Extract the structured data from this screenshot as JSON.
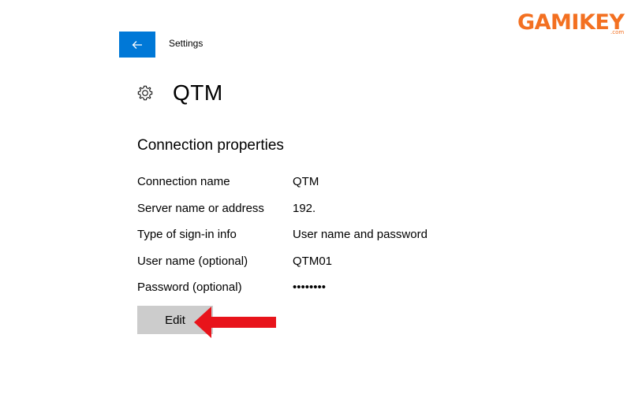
{
  "header": {
    "back_icon": "arrow-left-icon",
    "app_title": "Settings"
  },
  "page": {
    "icon": "gear-icon",
    "title": "QTM"
  },
  "section": {
    "title": "Connection properties"
  },
  "properties": [
    {
      "label": "Connection name",
      "value": "QTM"
    },
    {
      "label": "Server name or address",
      "value": "192."
    },
    {
      "label": "Type of sign-in info",
      "value": "User name and password"
    },
    {
      "label": "User name (optional)",
      "value": "QTM01"
    },
    {
      "label": "Password (optional)",
      "value": "••••••••"
    }
  ],
  "actions": {
    "edit_label": "Edit"
  },
  "annotation": {
    "arrow_color": "#e8141b",
    "arrow_icon": "arrow-pointer-icon"
  },
  "watermark": {
    "brand": "GAMIKEY",
    "domain": ".com",
    "color": "#f37021"
  },
  "colors": {
    "accent": "#0078d7",
    "button_bg": "#cccccc"
  }
}
